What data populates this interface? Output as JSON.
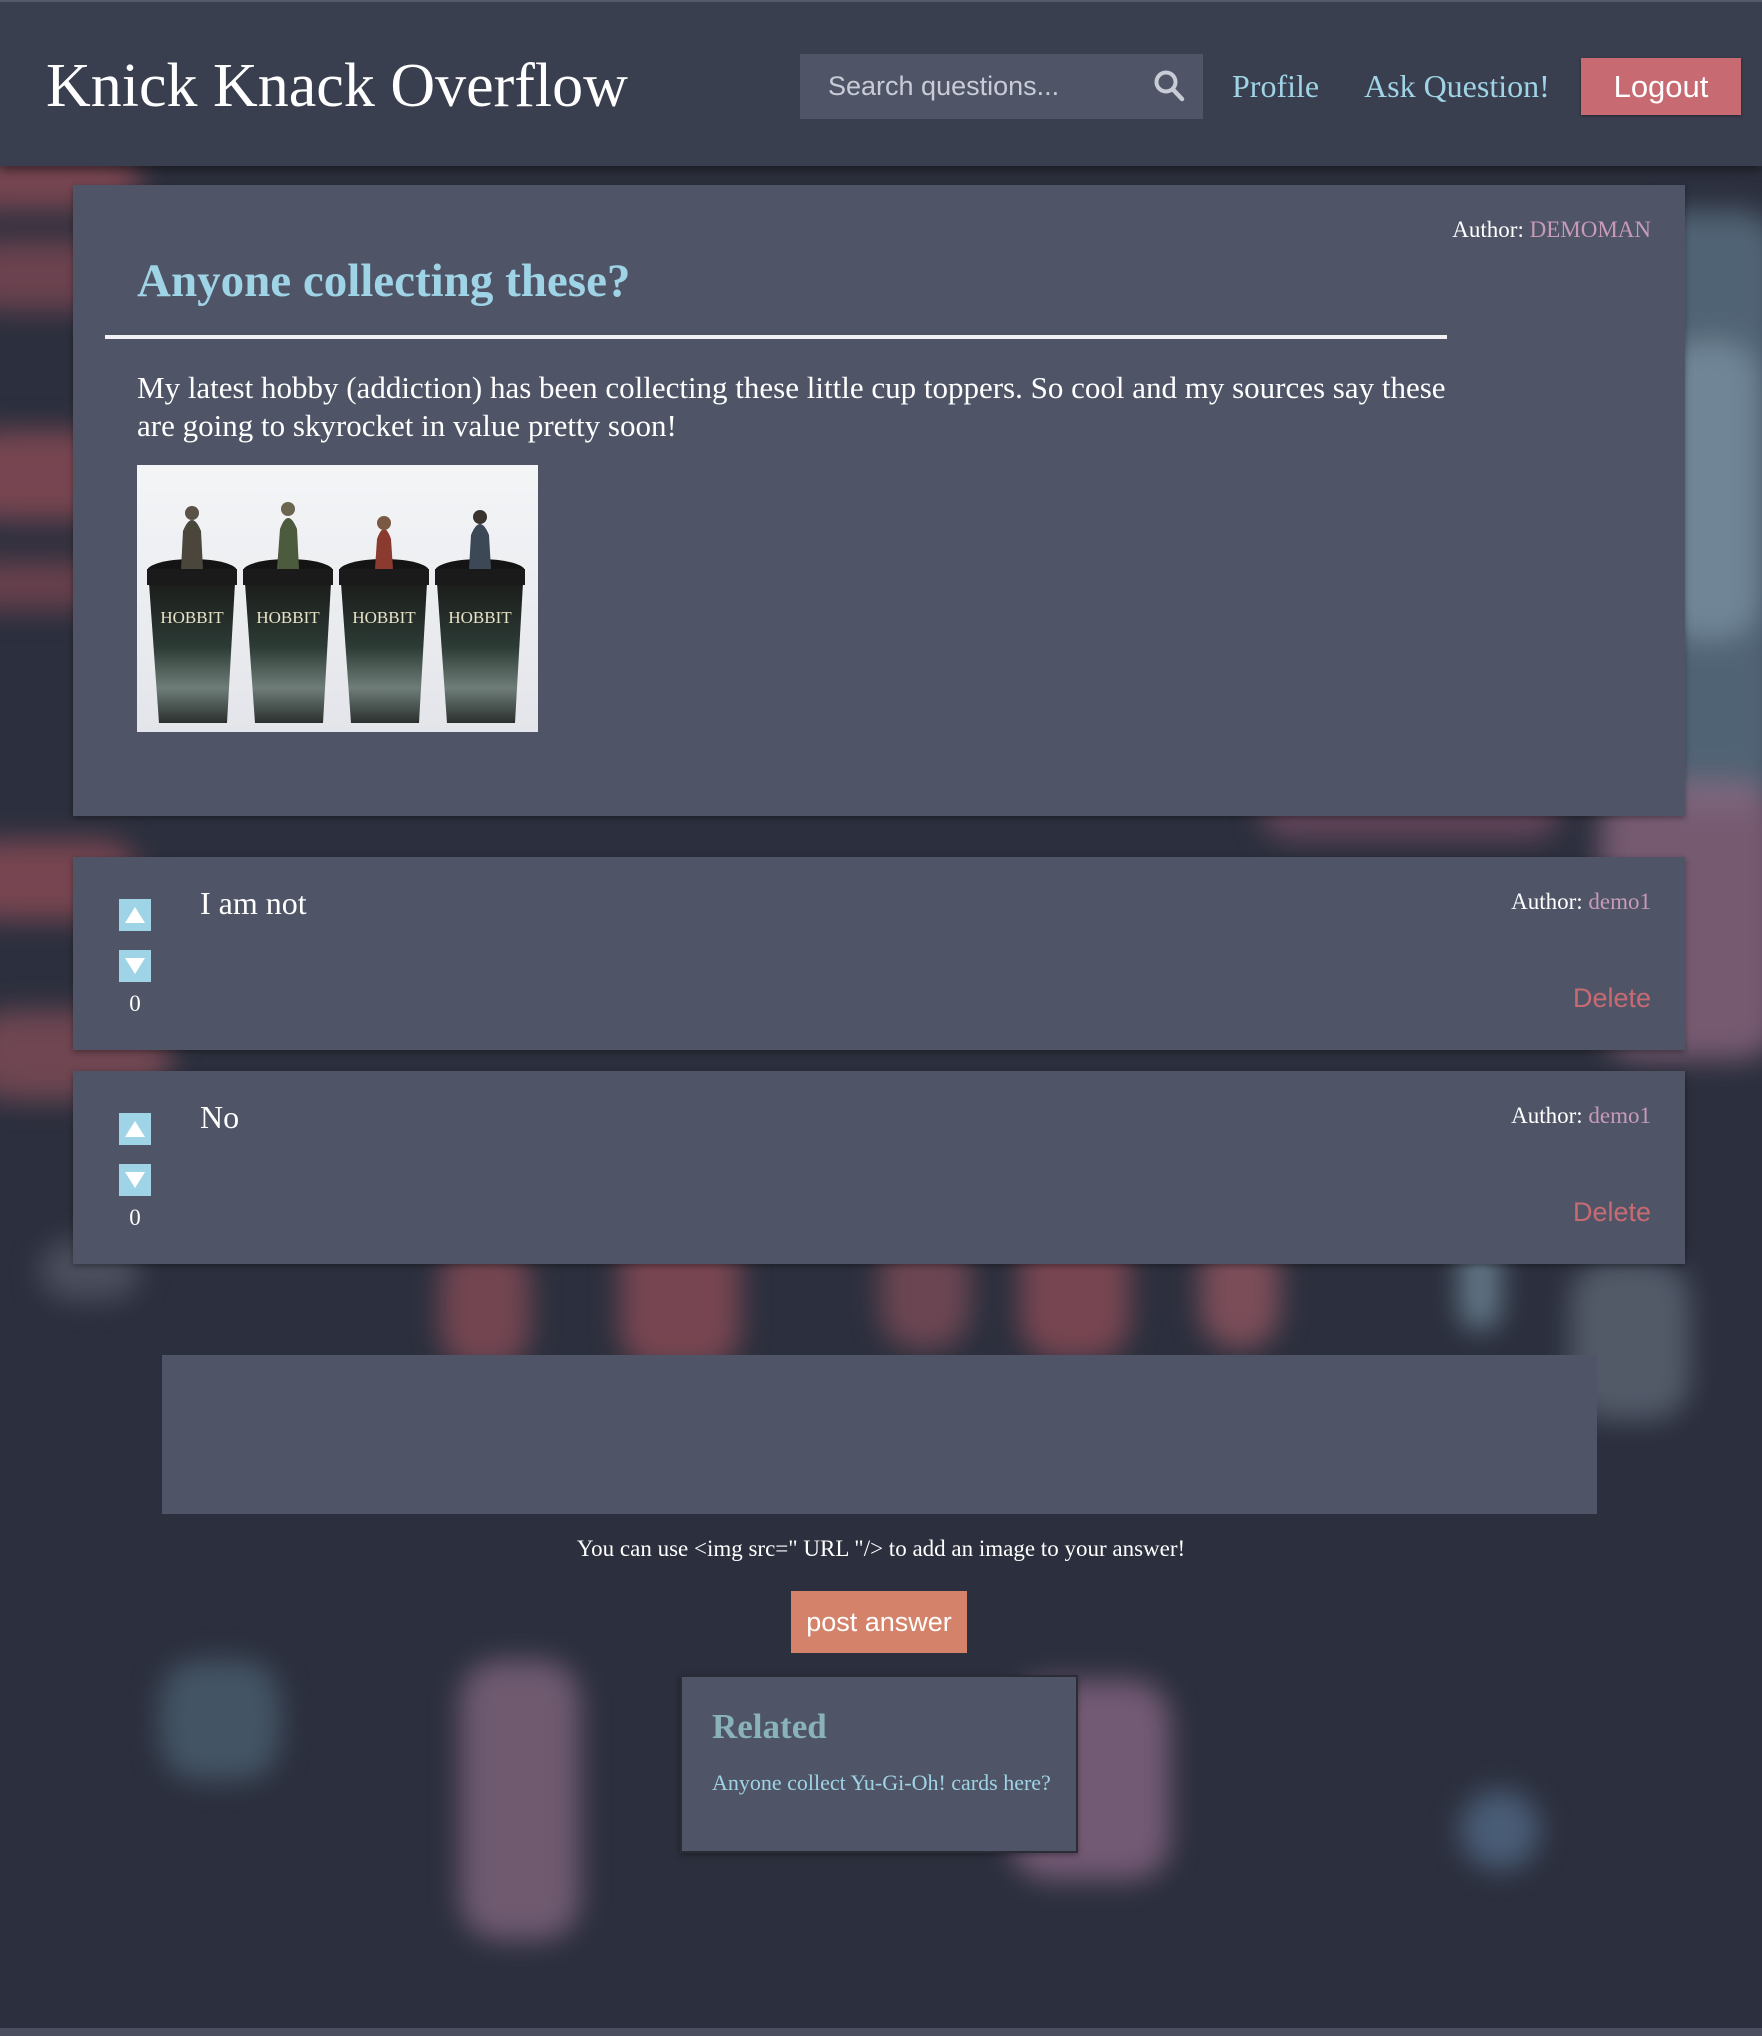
{
  "header": {
    "site_title": "Knick Knack Overflow",
    "search_placeholder": "Search questions...",
    "nav": {
      "profile": "Profile",
      "ask": "Ask Question!"
    },
    "logout_label": "Logout"
  },
  "question": {
    "author_label": "Author:",
    "author": "DEMOMAN",
    "title": "Anyone collecting these?",
    "body": "My latest hobby (addiction) has been collecting these little cup toppers. So cool and my sources say these are going to skyrocket in value pretty soon!",
    "image_labels": [
      "HOBBIT",
      "HOBBIT",
      "HOBBIT",
      "HOBBIT"
    ]
  },
  "answers": [
    {
      "text": "I am not",
      "author_label": "Author:",
      "author": "demo1",
      "votes": "0",
      "delete_label": "Delete"
    },
    {
      "text": "No",
      "author_label": "Author:",
      "author": "demo1",
      "votes": "0",
      "delete_label": "Delete"
    }
  ],
  "answer_form": {
    "value": "",
    "hint": "You can use <img src=\" URL \"/> to add an image to your answer!",
    "post_label": "post answer"
  },
  "related": {
    "title": "Related",
    "items": [
      {
        "label": "Anyone collect Yu-Gi-Oh! cards here?"
      }
    ]
  },
  "colors": {
    "header_bg": "#3a3f4f",
    "card_bg": "#4f5567",
    "accent_blue": "#9fd3e6",
    "logout_red": "#c86a72",
    "post_orange": "#d4826a",
    "author_pink": "#c79ab8"
  }
}
